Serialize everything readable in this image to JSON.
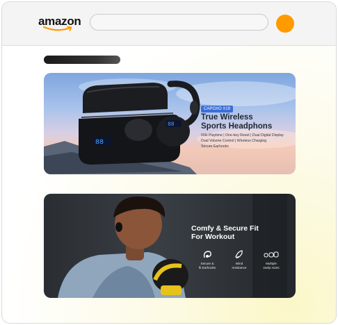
{
  "header": {
    "logo_text": "amazon",
    "logo_color": "#111111",
    "smile_color": "#ff9900",
    "search": {
      "placeholder": ""
    },
    "avatar_color": "#ff9a00"
  },
  "banner_1": {
    "brand_chip": "CAPOXO X19",
    "heading_line1": "True Wireless",
    "heading_line2": "Sports Headphons",
    "specs_line1": "60H Playtime | One-key Reset | Dual Digital Display",
    "specs_line2": "Dual Volume Control | Wireless Charging",
    "specs_line3": "Secure Earhooks",
    "display_digits_case": "88",
    "display_digits_bud": "88"
  },
  "banner_2": {
    "heading_line1": "Comfy & Secure Fit",
    "heading_line2": "For Workout",
    "features": [
      {
        "icon": "earhook-icon",
        "label_line1": "Secure &",
        "label_line2": "fit Earhooks"
      },
      {
        "icon": "wind-icon",
        "label_line1": "Wind",
        "label_line2": "resistance"
      },
      {
        "icon": "eartips-icon",
        "label_line1": "Multiple",
        "label_line2": "eartip sizes"
      }
    ]
  }
}
